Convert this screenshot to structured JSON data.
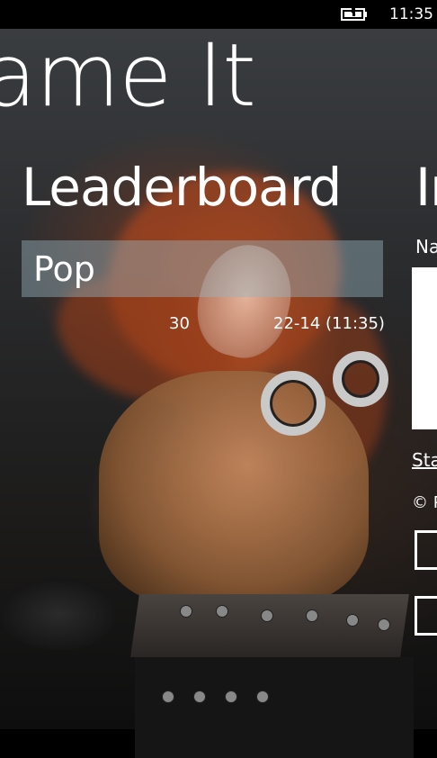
{
  "status_bar": {
    "time": "11:35",
    "battery_icon": "battery-charging-icon"
  },
  "app": {
    "title": "ame It"
  },
  "leaderboard": {
    "header": "Leaderboard",
    "items": [
      {
        "label": "Pop",
        "score": "30",
        "date": "22-14 (11:35)"
      }
    ]
  },
  "info": {
    "header": "Ir",
    "name_label": "Na",
    "start_link": "Sta",
    "copyright": "© P"
  }
}
